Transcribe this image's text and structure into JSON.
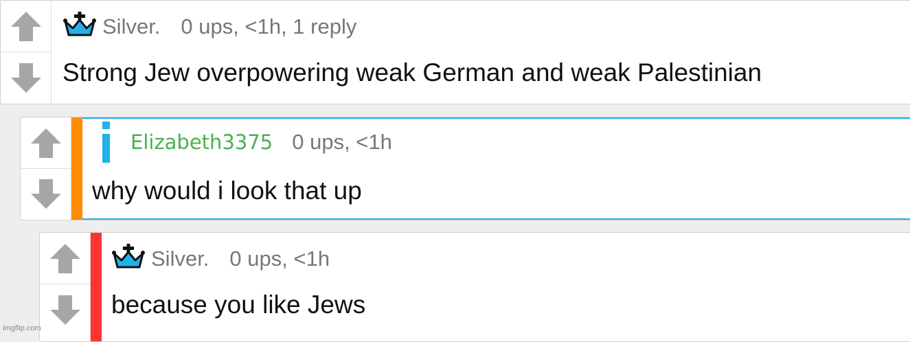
{
  "comments": [
    {
      "username": "Silver.",
      "meta": "0 ups, <1h, 1 reply",
      "body": "Strong Jew overpowering weak German and weak Palestinian",
      "badge": "crown-icon",
      "username_color": "#777777"
    },
    {
      "username": "Elizabeth3375",
      "meta": "0 ups, <1h",
      "body": "why would i look that up",
      "badge": "info-icon",
      "username_color": "#4caf50",
      "thread_bar_color": "#ff8c00",
      "highlight_border_color": "#21b0e8"
    },
    {
      "username": "Silver.",
      "meta": "0 ups, <1h",
      "body": "because you like Jews",
      "badge": "crown-icon",
      "username_color": "#777777",
      "thread_bar_color": "#ff3333"
    }
  ],
  "colors": {
    "background": "#eeeeee",
    "vote_arrow": "#a6a6a6",
    "crown_fill": "#21b0e8"
  },
  "watermark": "imgflip.com"
}
